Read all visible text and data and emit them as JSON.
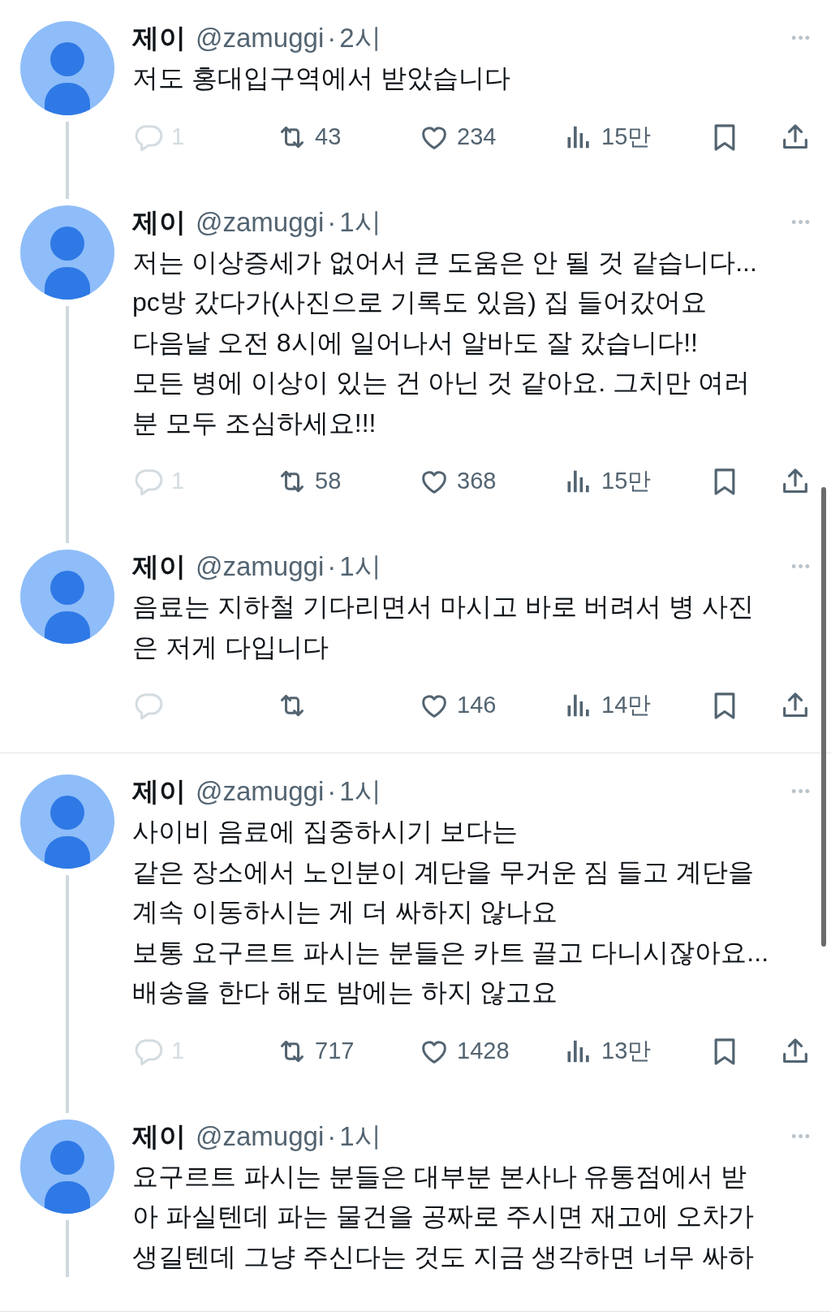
{
  "tweets": [
    {
      "name": "제이",
      "handle": "@zamuggi",
      "separator": "·",
      "time": "2시",
      "more": "•••",
      "lines": [
        "저도 홍대입구역에서 받았습니다"
      ],
      "reply": {
        "count": "1",
        "disabled": true
      },
      "retweets": "43",
      "likes": "234",
      "views": "15만",
      "connected_to_next": true
    },
    {
      "name": "제이",
      "handle": "@zamuggi",
      "separator": "·",
      "time": "1시",
      "more": "•••",
      "lines": [
        "저는 이상증세가 없어서 큰 도움은 안 될 것 같습니다...",
        "pc방 갔다가(사진으로 기록도 있음) 집 들어갔어요",
        "다음날 오전 8시에 일어나서 알바도 잘 갔습니다!!",
        "모든 병에 이상이 있는 건 아닌 것 같아요. 그치만 여러",
        "분 모두 조심하세요!!!"
      ],
      "reply": {
        "count": "1",
        "disabled": true
      },
      "retweets": "58",
      "likes": "368",
      "views": "15만",
      "connected_to_next": true
    },
    {
      "name": "제이",
      "handle": "@zamuggi",
      "separator": "·",
      "time": "1시",
      "more": "•••",
      "lines": [
        "음료는 지하철 기다리면서 마시고 바로 버려서 병 사진",
        "은 저게 다입니다"
      ],
      "reply": {
        "disabled": true
      },
      "likes": "146",
      "views": "14만",
      "connected_to_next": false
    },
    {
      "name": "제이",
      "handle": "@zamuggi",
      "separator": "·",
      "time": "1시",
      "more": "•••",
      "lines": [
        "사이비 음료에 집중하시기 보다는",
        "같은 장소에서 노인분이 계단을 무거운 짐 들고 계단을",
        "계속 이동하시는 게 더 싸하지 않나요",
        "보통 요구르트 파시는 분들은 카트 끌고 다니시잖아요...",
        "배송을 한다 해도 밤에는 하지 않고요"
      ],
      "reply": {
        "count": "1",
        "disabled": true
      },
      "retweets": "717",
      "likes": "1428",
      "views": "13만",
      "connected_to_next": true
    },
    {
      "name": "제이",
      "handle": "@zamuggi",
      "separator": "·",
      "time": "1시",
      "more": "•••",
      "lines": [
        "요구르트 파시는 분들은 대부분 본사나 유통점에서 받",
        "아 파실텐데 파는 물건을 공짜로 주시면 재고에 오차가",
        "생길텐데 그냥 주신다는 것도 지금 생각하면 너무 싸하"
      ],
      "connected_to_next": true
    }
  ]
}
